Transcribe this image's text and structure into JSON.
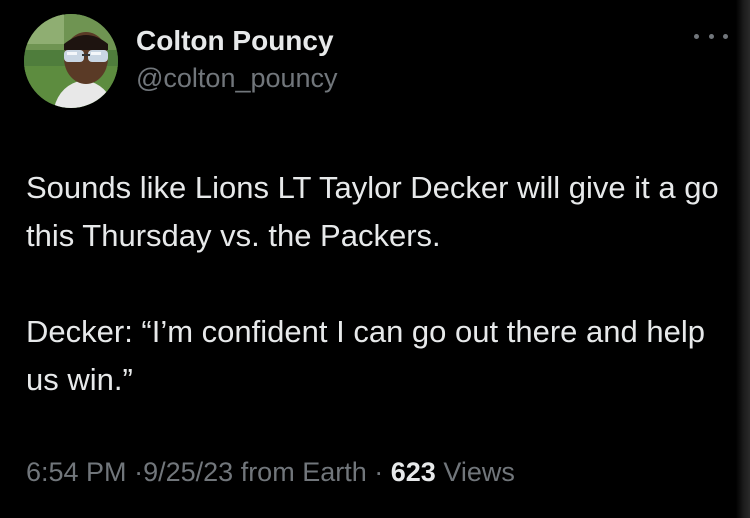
{
  "author": {
    "display_name": "Colton Pouncy",
    "handle": "@colton_pouncy"
  },
  "tweet": {
    "paragraphs": [
      "Sounds like Lions LT Taylor Decker will give it a go this Thursday vs. the Packers.",
      "Decker: “I’m confident I can go out there and help us win.”"
    ]
  },
  "meta": {
    "time": "6:54 PM",
    "separator": "·",
    "date": "9/25/23",
    "source": "from Earth",
    "views_count": "623",
    "views_label": "Views"
  },
  "icons": {
    "more": "more-options-icon",
    "avatar": "profile-avatar"
  },
  "colors": {
    "background": "#000000",
    "primary_text": "#e7e9ea",
    "secondary_text": "#71767b"
  }
}
